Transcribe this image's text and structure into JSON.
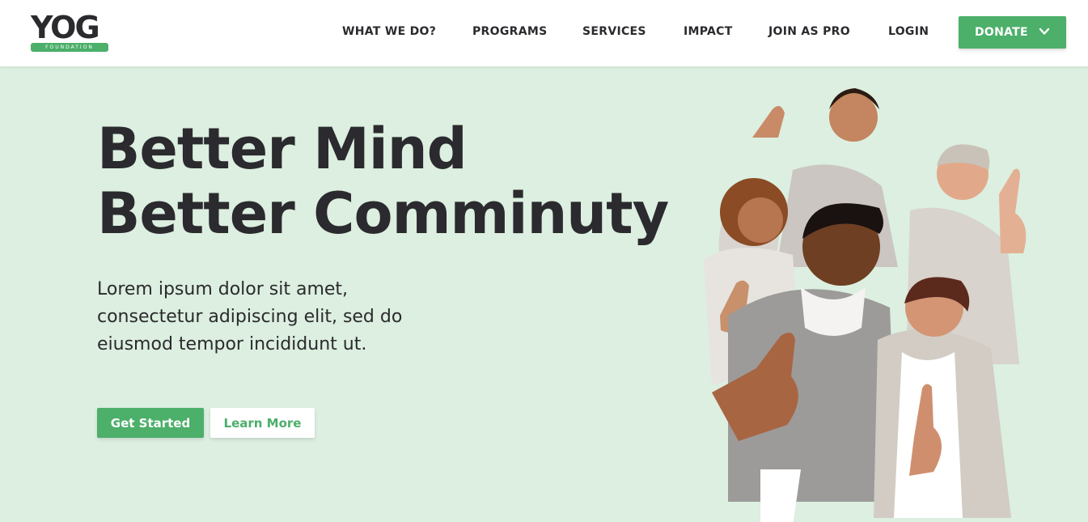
{
  "brand": {
    "logo_word": "YOG",
    "logo_tag": "FOUNDATION",
    "accent": "#4caf6a",
    "hero_bg": "#dcefe0",
    "text": "#2b2a2e"
  },
  "nav": {
    "items": [
      {
        "label": "WHAT WE DO?"
      },
      {
        "label": "PROGRAMS"
      },
      {
        "label": "SERVICES"
      },
      {
        "label": "IMPACT"
      },
      {
        "label": "JOIN AS PRO"
      },
      {
        "label": "LOGIN"
      }
    ],
    "donate_label": "DONATE",
    "donate_icon": "chevron-down-icon"
  },
  "hero": {
    "headline_line1": "Better Mind",
    "headline_line2": "Better Comminuty",
    "lede": "Lorem ipsum dolor sit amet, consectetur adipiscing elit, sed do eiusmod tempor incididunt ut.",
    "primary_cta": "Get Started",
    "secondary_cta": "Learn More",
    "image": "group-of-people-thumbs-up"
  }
}
